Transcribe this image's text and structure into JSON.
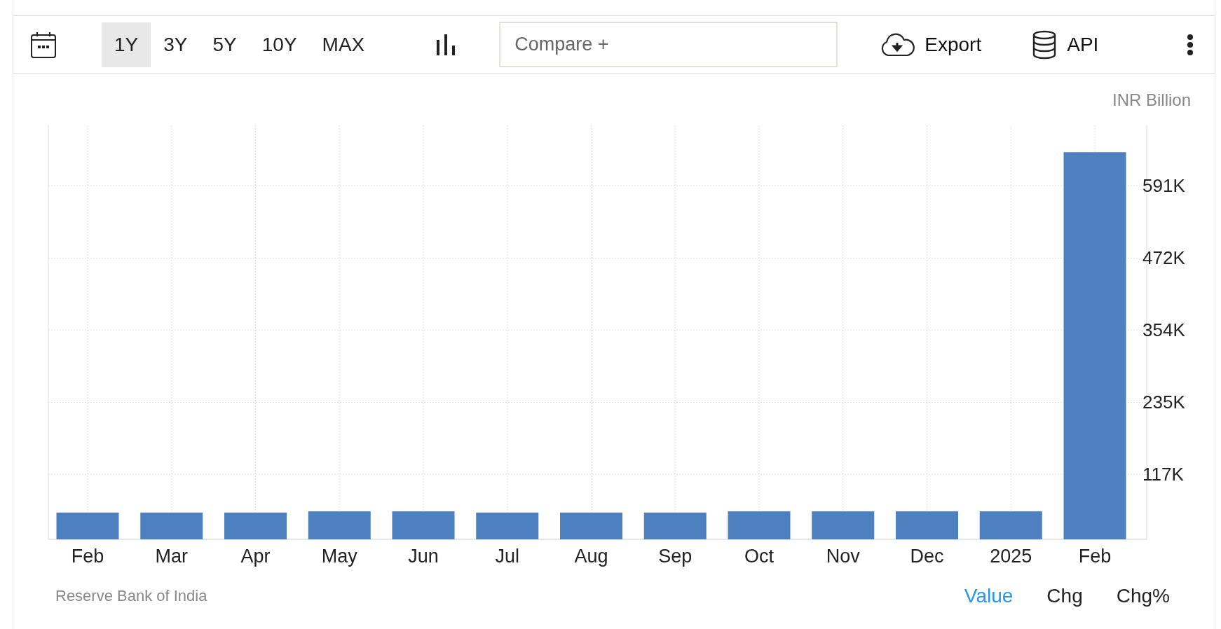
{
  "toolbar": {
    "ranges": [
      {
        "label": "1Y",
        "selected": true
      },
      {
        "label": "3Y",
        "selected": false
      },
      {
        "label": "5Y",
        "selected": false
      },
      {
        "label": "10Y",
        "selected": false
      },
      {
        "label": "MAX",
        "selected": false
      }
    ],
    "compare": {
      "placeholder": "Compare +"
    },
    "actions": [
      {
        "kind": "export",
        "label": "Export"
      },
      {
        "kind": "api",
        "label": "API"
      }
    ]
  },
  "chart": {
    "unit": "INR Billion",
    "chart_data": {
      "type": "bar",
      "categories": [
        "Feb",
        "Mar",
        "Apr",
        "May",
        "Jun",
        "Jul",
        "Aug",
        "Sep",
        "Oct",
        "Nov",
        "Dec",
        "2025",
        "Feb"
      ],
      "values": [
        54000,
        54000,
        54000,
        56000,
        56000,
        54000,
        54000,
        54000,
        56000,
        56000,
        56000,
        56000,
        646000
      ],
      "ylim": [
        10000,
        690000
      ],
      "grid": true,
      "yticks": [
        {
          "value": 117000,
          "label": "117K"
        },
        {
          "value": 235000,
          "label": "235K"
        },
        {
          "value": 354000,
          "label": "354K"
        },
        {
          "value": 472000,
          "label": "472K"
        },
        {
          "value": 591000,
          "label": "591K"
        }
      ]
    }
  },
  "footer": {
    "source": "Reserve Bank of India",
    "views": [
      {
        "label": "Value",
        "selected": true
      },
      {
        "label": "Chg",
        "selected": false
      },
      {
        "label": "Chg%",
        "selected": false
      }
    ]
  }
}
